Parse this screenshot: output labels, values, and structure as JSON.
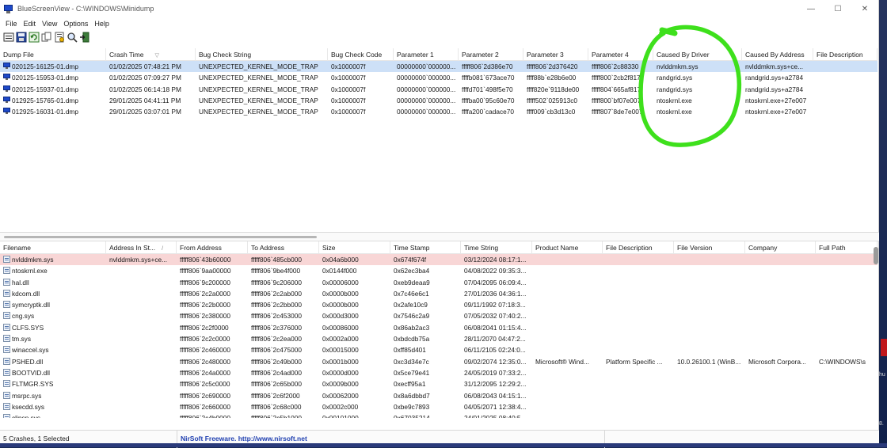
{
  "window": {
    "title": "BlueScreenView  -  C:\\WINDOWS\\Minidump",
    "minimize": "—",
    "maximize": "☐",
    "close": "✕"
  },
  "menu": [
    "File",
    "Edit",
    "View",
    "Options",
    "Help"
  ],
  "toolbar": [
    "save-html-icon",
    "save-icon",
    "refresh-icon",
    "copy-icon",
    "properties-icon",
    "find-icon",
    "exit-icon"
  ],
  "top_table": {
    "columns": [
      "Dump File",
      "Crash Time",
      "Bug Check String",
      "Bug Check Code",
      "Parameter 1",
      "Parameter 2",
      "Parameter 3",
      "Parameter 4",
      "Caused By Driver",
      "Caused By Address",
      "File Description"
    ],
    "sort_indicator": "▽",
    "rows": [
      [
        "020125-16125-01.dmp",
        "01/02/2025 07:48:21 PM",
        "UNEXPECTED_KERNEL_MODE_TRAP",
        "0x1000007f",
        "00000000`000000...",
        "fffff806`2d386e70",
        "fffff806`2d376420",
        "fffff806`2c88330",
        "nvlddmkm.sys",
        "nvlddmkm.sys+ce...",
        ""
      ],
      [
        "020125-15953-01.dmp",
        "01/02/2025 07:09:27 PM",
        "UNEXPECTED_KERNEL_MODE_TRAP",
        "0x1000007f",
        "00000000`000000...",
        "ffffb081`673ace70",
        "ffff88b`e28b6e00",
        "fffff800`2cb2f817",
        "randgrid.sys",
        "randgrid.sys+a2784",
        ""
      ],
      [
        "020125-15937-01.dmp",
        "01/02/2025 06:14:18 PM",
        "UNEXPECTED_KERNEL_MODE_TRAP",
        "0x1000007f",
        "00000000`000000...",
        "ffffd701`498f5e70",
        "ffff820e`9118de00",
        "fffff804`665af817",
        "randgrid.sys",
        "randgrid.sys+a2784",
        ""
      ],
      [
        "012925-15765-01.dmp",
        "29/01/2025 04:41:11 PM",
        "UNEXPECTED_KERNEL_MODE_TRAP",
        "0x1000007f",
        "00000000`000000...",
        "ffffba00`95c60e70",
        "fffff502`025913c0",
        "fffff800`bf07e007",
        "ntoskrnl.exe",
        "ntoskrnl.exe+27e007",
        ""
      ],
      [
        "012925-16031-01.dmp",
        "29/01/2025 03:07:01 PM",
        "UNEXPECTED_KERNEL_MODE_TRAP",
        "0x1000007f",
        "00000000`000000...",
        "ffffa200`cadace70",
        "ffff009`cb3d13c0",
        "fffff807`8de7e007",
        "ntoskrnl.exe",
        "ntoskrnl.exe+27e007",
        ""
      ]
    ]
  },
  "bottom_table": {
    "columns": [
      "Filename",
      "Address In St...",
      "From Address",
      "To Address",
      "Size",
      "Time Stamp",
      "Time String",
      "Product Name",
      "File Description",
      "File Version",
      "Company",
      "Full Path"
    ],
    "sort_indicator": "/",
    "rows": [
      [
        "nvlddmkm.sys",
        "nvlddmkm.sys+ce...",
        "fffff806`43b60000",
        "fffff806`485cb000",
        "0x04a6b000",
        "0x674f674f",
        "03/12/2024 08:17:1...",
        "",
        "",
        "",
        "",
        ""
      ],
      [
        "ntoskrnl.exe",
        "",
        "fffff806`9aa00000",
        "fffff806`9be4f000",
        "0x0144f000",
        "0x62ec3ba4",
        "04/08/2022 09:35:3...",
        "",
        "",
        "",
        "",
        ""
      ],
      [
        "hal.dll",
        "",
        "fffff806`9c200000",
        "fffff806`9c206000",
        "0x00006000",
        "0xeb9deaa9",
        "07/04/2095 06:09:4...",
        "",
        "",
        "",
        "",
        ""
      ],
      [
        "kdcom.dll",
        "",
        "fffff806`2c2a0000",
        "fffff806`2c2ab000",
        "0x0000b000",
        "0x7c46e6c1",
        "27/01/2036 04:36:1...",
        "",
        "",
        "",
        "",
        ""
      ],
      [
        "symcryptk.dll",
        "",
        "fffff806`2c2b0000",
        "fffff806`2c2bb000",
        "0x0000b000",
        "0x2afe10c9",
        "09/11/1992 07:18:3...",
        "",
        "",
        "",
        "",
        ""
      ],
      [
        "cng.sys",
        "",
        "fffff806`2c380000",
        "fffff806`2c453000",
        "0x000d3000",
        "0x7546c2a9",
        "07/05/2032 07:40:2...",
        "",
        "",
        "",
        "",
        ""
      ],
      [
        "CLFS.SYS",
        "",
        "fffff806`2c2f0000",
        "fffff806`2c376000",
        "0x00086000",
        "0x86ab2ac3",
        "06/08/2041 01:15:4...",
        "",
        "",
        "",
        "",
        ""
      ],
      [
        "tm.sys",
        "",
        "fffff806`2c2c0000",
        "fffff806`2c2ea000",
        "0x0002a000",
        "0xbdcdb75a",
        "28/11/2070 04:47:2...",
        "",
        "",
        "",
        "",
        ""
      ],
      [
        "winaccel.sys",
        "",
        "fffff806`2c460000",
        "fffff806`2c475000",
        "0x00015000",
        "0xff85d401",
        "06/11/2105 02:24:0...",
        "",
        "",
        "",
        "",
        ""
      ],
      [
        "PSHED.dll",
        "",
        "fffff806`2c480000",
        "fffff806`2c49b000",
        "0x0001b000",
        "0xc3d34e7c",
        "09/02/2074 12:35:0...",
        "Microsoft® Wind...",
        "Platform Specific ...",
        "10.0.26100.1 (WinB...",
        "Microsoft Corpora...",
        "C:\\WINDOWS\\s"
      ],
      [
        "BOOTVID.dll",
        "",
        "fffff806`2c4a0000",
        "fffff806`2c4ad000",
        "0x0000d000",
        "0x5ce79e41",
        "24/05/2019 07:33:2...",
        "",
        "",
        "",
        "",
        ""
      ],
      [
        "FLTMGR.SYS",
        "",
        "fffff806`2c5c0000",
        "fffff806`2c65b000",
        "0x0009b000",
        "0xecff95a1",
        "31/12/2095 12:29:2...",
        "",
        "",
        "",
        "",
        ""
      ],
      [
        "msrpc.sys",
        "",
        "fffff806`2c690000",
        "fffff806`2c6f2000",
        "0x00062000",
        "0x8a6dbbd7",
        "06/08/2043 04:15:1...",
        "",
        "",
        "",
        "",
        ""
      ],
      [
        "ksecdd.sys",
        "",
        "fffff806`2c660000",
        "fffff806`2c68c000",
        "0x0002c000",
        "0xbe9c7893",
        "04/05/2071 12:38:4...",
        "",
        "",
        "",
        "",
        ""
      ],
      [
        "clipsp.sys",
        "",
        "fffff806`2c4b0000",
        "fffff806`2c5b1000",
        "0x00101000",
        "0x67035214",
        "24/01/2025 08:40:5...",
        "",
        "",
        "",
        "",
        ""
      ]
    ]
  },
  "status": {
    "count": "5 Crashes, 1 Selected",
    "link": "NirSoft Freeware.  http://www.nirsoft.net"
  },
  "desktop": {
    "label_top": "hu",
    "label_bottom": "8."
  },
  "colors": {
    "selected_row": "#cde0f7",
    "highlight_row": "#f8d6d6",
    "annotation": "#3ee01c",
    "link": "#1f3fb0"
  }
}
